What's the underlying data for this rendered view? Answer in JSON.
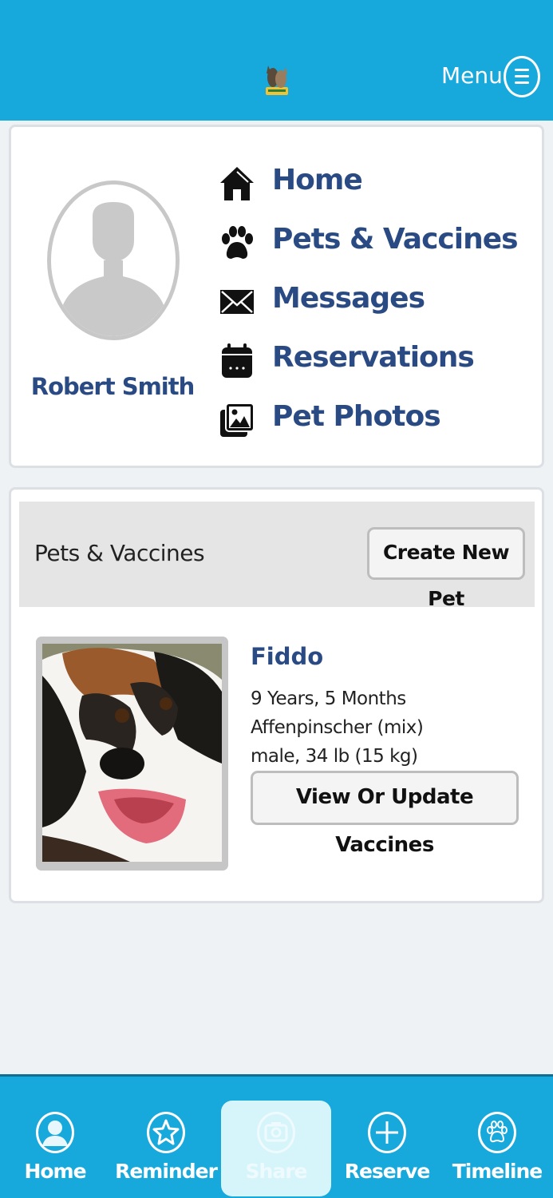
{
  "header": {
    "menu_label": "Menu",
    "logo_icon": "dog-cat-logo-icon",
    "menu_icon": "hamburger-menu-icon"
  },
  "profile": {
    "user_name": "Robert Smith",
    "avatar_icon": "person-silhouette-icon",
    "nav": [
      {
        "label": "Home",
        "icon": "house-icon"
      },
      {
        "label": "Pets & Vaccines",
        "icon": "paw-icon"
      },
      {
        "label": "Messages",
        "icon": "envelope-icon"
      },
      {
        "label": "Reservations",
        "icon": "calendar-icon"
      },
      {
        "label": "Pet Photos",
        "icon": "photos-icon"
      }
    ]
  },
  "pets": {
    "section_title": "Pets & Vaccines",
    "create_label": "Create New Pet",
    "items": [
      {
        "name": "Fiddo",
        "age": "9 Years, 5 Months",
        "breed": "Affenpinscher (mix)",
        "details": "male, 34 lb (15 kg)",
        "button_label": "View Or Update Vaccines"
      }
    ]
  },
  "tabbar": {
    "tabs": [
      {
        "label": "Home",
        "icon": "person-icon",
        "active": false
      },
      {
        "label": "Reminder",
        "icon": "star-icon",
        "active": false
      },
      {
        "label": "Share",
        "icon": "camera-icon",
        "active": true
      },
      {
        "label": "Reserve",
        "icon": "plus-icon",
        "active": false
      },
      {
        "label": "Timeline",
        "icon": "paw-icon",
        "active": false
      }
    ]
  },
  "colors": {
    "header_bg": "#17a8dc",
    "link_blue": "#2a4a84",
    "page_bg": "#eff2f5"
  }
}
